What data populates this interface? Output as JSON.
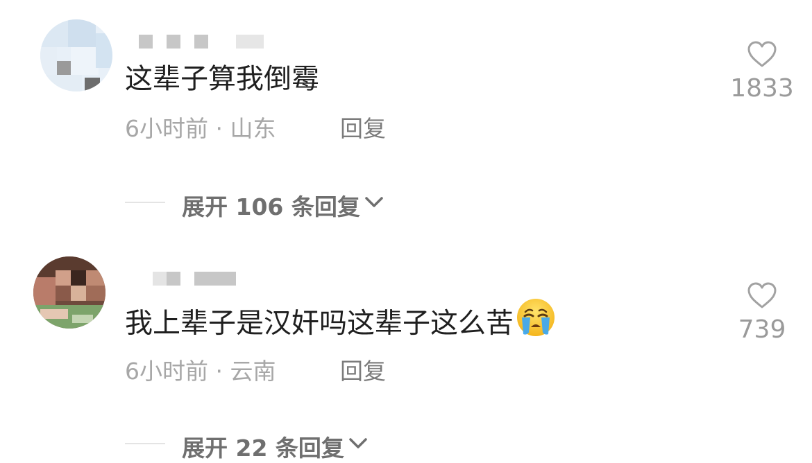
{
  "comments": [
    {
      "text": "这辈子算我倒霉",
      "time": "6小时前",
      "separator": " · ",
      "location": "山东",
      "reply_label": "回复",
      "like_count": "1833",
      "expand_label": "展开 106 条回复"
    },
    {
      "text": "我上辈子是汉奸吗这辈子这么苦",
      "emoji": "crying-face",
      "time": "6小时前",
      "separator": " · ",
      "location": "云南",
      "reply_label": "回复",
      "like_count": "739",
      "expand_label": "展开 22 条回复"
    }
  ],
  "colors": {
    "text": "#1f1f1f",
    "meta": "#a7a7a7",
    "reply": "#7b7b7b",
    "like": "#9a9a9a",
    "expand": "#6f6f6f"
  }
}
